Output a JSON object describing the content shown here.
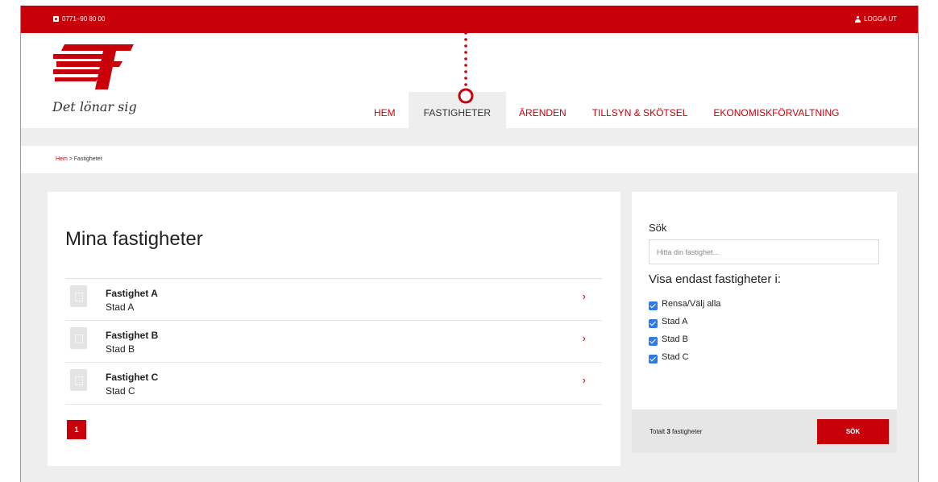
{
  "topbar": {
    "phone_icon": "phone-icon",
    "phone": "0771–90 80 00",
    "logout_icon": "user-icon",
    "logout": "LOGGA UT"
  },
  "brand": {
    "slogan": "Det lönar sig",
    "color": "#c8000a"
  },
  "nav": {
    "items": [
      {
        "label": "HEM"
      },
      {
        "label": "FASTIGHETER",
        "active": true
      },
      {
        "label": "ÄRENDEN"
      },
      {
        "label": "TILLSYN & SKÖTSEL"
      },
      {
        "label": "EKONOMISKFÖRVALTNING"
      }
    ]
  },
  "breadcrumb": {
    "home": "Hem",
    "separator": ">",
    "current": "Fastigheter"
  },
  "main": {
    "title": "Mina fastigheter",
    "items": [
      {
        "name": "Fastighet A",
        "city": "Stad A"
      },
      {
        "name": "Fastighet B",
        "city": "Stad B"
      },
      {
        "name": "Fastighet C",
        "city": "Stad C"
      }
    ],
    "chevron": "›",
    "page": "1"
  },
  "sidebar": {
    "search_title": "Sök",
    "search_placeholder": "Hitta din fastighet...",
    "filter_title": "Visa endast fastigheter i:",
    "checks": [
      {
        "label": "Rensa/Välj alla",
        "checked": true
      },
      {
        "label": "Stad A",
        "checked": true
      },
      {
        "label": "Stad B",
        "checked": true
      },
      {
        "label": "Stad C",
        "checked": true
      }
    ],
    "total_prefix": "Totalt",
    "total_count": "3",
    "total_suffix": "fastigheter",
    "search_button": "SÖK"
  }
}
